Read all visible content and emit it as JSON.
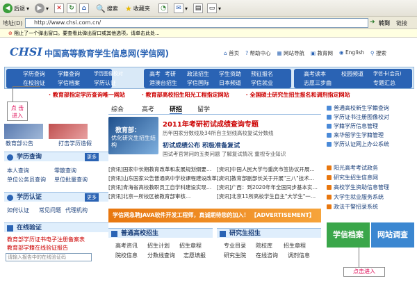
{
  "toolbar": {
    "back": "后退",
    "search": "搜索",
    "favorites": "收藏夹"
  },
  "address": {
    "label": "地址(D)",
    "url": "http://www.chsi.com.cn/",
    "go": "转到",
    "links": "链接"
  },
  "popup": "阻止了一个弹出窗口。要查看此弹出窗口或其他选项，请单击此处...",
  "site": {
    "logo": "CHSI",
    "title": "中国高等教育学生信息网(学信网)",
    "links": [
      "首页",
      "帮助中心",
      "网站导航",
      "教育网",
      "English",
      "搜索"
    ]
  },
  "nav": {
    "g1": [
      "学历查询",
      "学籍查询",
      "学历图像校对",
      "在校验证",
      "学信档案",
      "学历认证"
    ],
    "g2": [
      "高考",
      "考研",
      "政法招生",
      "学生资助",
      "预征报名",
      "港澳台招生",
      "学信国际",
      "日本频道",
      "学信就业"
    ],
    "g3": [
      "高考读本",
      "校园频道",
      "学信卡(会员)",
      "志愿三步曲",
      "专题汇总"
    ]
  },
  "marquee": [
    "· 教育部指定学历查询唯一网站",
    "· 教育部高校招生阳光工程指定网站",
    "· 全国硕士研究生招生报名和调剂指定网站"
  ],
  "tabs": [
    "综合",
    "高考",
    "研招",
    "留学"
  ],
  "feature": {
    "banner_title": "教育部：",
    "banner_sub": "优化研究生招生结构",
    "headline": "2011年考研初试成绩查询专题",
    "desc": "历年国家分数线及34所自主划线高校复试分数线",
    "sub_headline": "初试成绩公布 积极准备复试",
    "sub_desc": "国试考官常问的五类问题 了解复试情况 重视专业知识"
  },
  "left": {
    "pics": [
      "教育部公告",
      "打击学历造假"
    ],
    "query_title": "学历查询",
    "query_links": [
      "本人查询",
      "零散查询",
      "单位公务员查询",
      "单位批量查询"
    ],
    "auth_title": "学历认证",
    "auth_links": [
      "如何认证",
      "常见问题",
      "代理机构"
    ],
    "verify_title": "在线验证",
    "verify_links": [
      "教育部学历证书电子注册备案表",
      "教育部学籍在线验证报告"
    ],
    "verify_input": "请输入报告中的在线验证码",
    "callout": "点 击\n进入"
  },
  "news": [
    "[资讯]国家中长期教育改革和发展规划纲要…",
    "[资讯]中国人民大学与重庆市签协议开展…",
    "[资讯]山东国家公告普通高中学校课程建设改革…",
    "[资讯]教育部副部长关于开展\"三八\"技术…",
    "[资讯]青海省高校教职员工自学科建设实现…",
    "[资讯]广西：到2020年年全国同步基本实…",
    "[资讯]北京一所校区被教育部审核…",
    "[资讯]北京11所高校学生自主\"大学生\"一…"
  ],
  "ad": "学信网急聘JAVA软件开发工程师，真诚期待您的加入！ 【ADVERTISEMENT】",
  "bottom": {
    "left_title": "普通高校招生",
    "left_links": [
      "高考资讯",
      "招生计划",
      "招生章程"
    ],
    "right_title": "研究生招生",
    "right_links": [
      "专业目录",
      "院校库",
      "招生章程"
    ],
    "left_links2": [
      "院校信息",
      "分数线查询",
      "志愿填报"
    ],
    "right_links2": [
      "研究生院",
      "在线咨询",
      "调剂信息"
    ]
  },
  "right": {
    "list1": [
      "普通高校新生学籍查询",
      "学历证书注册图像校对",
      "学籍学历信息管理",
      "来华留学生学籍管理",
      "学历认证网上办公系统"
    ],
    "list2": [
      "阳光高考考试政务",
      "研究生招生信息网",
      "高校学生资助信息管理",
      "大学生就业服务系统",
      "政法干警招录系统"
    ],
    "tiles": [
      "学信档案",
      "网站调查"
    ],
    "callout": "点击进入"
  }
}
